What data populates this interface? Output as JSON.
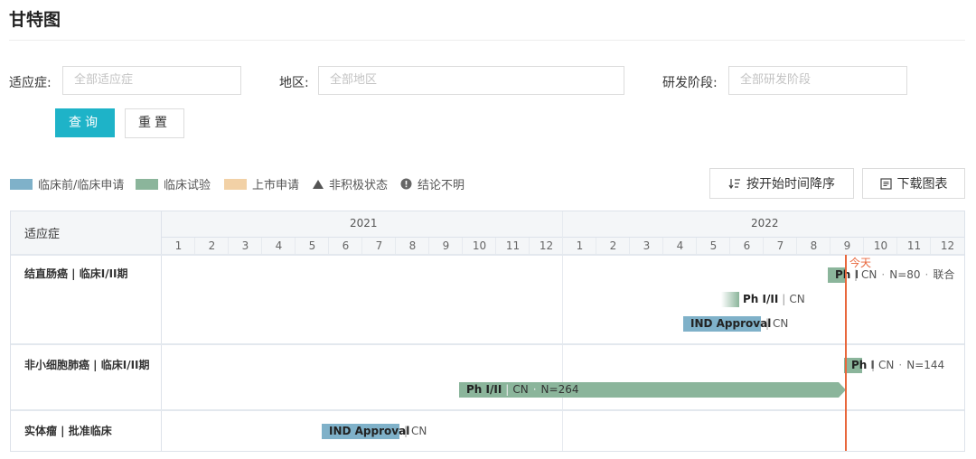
{
  "page": {
    "title": "甘特图"
  },
  "filters": {
    "indication": {
      "label": "适应症:",
      "placeholder": "全部适应症"
    },
    "region": {
      "label": "地区:",
      "placeholder": "全部地区"
    },
    "stage": {
      "label": "研发阶段:",
      "placeholder": "全部研发阶段"
    },
    "query_button": "查询",
    "reset_button": "重置"
  },
  "legend": {
    "preclinical": {
      "label": "临床前/临床申请",
      "color": "#7fb1c9"
    },
    "clinical": {
      "label": "临床试验",
      "color": "#8bb59b"
    },
    "market": {
      "label": "上市申请",
      "color": "#f2d1a6"
    },
    "inactive": {
      "label": "非积极状态",
      "icon": "triangle-icon"
    },
    "unknown": {
      "label": "结论不明",
      "icon": "info-circle-icon"
    }
  },
  "toolbar": {
    "sort_button": "按开始时间降序",
    "download_button": "下载图表"
  },
  "gantt": {
    "column_header": "适应症",
    "years": [
      "2021",
      "2022"
    ],
    "months": [
      "1",
      "2",
      "3",
      "4",
      "5",
      "6",
      "7",
      "8",
      "9",
      "10",
      "11",
      "12"
    ],
    "today_label": "今天",
    "today_color": "#e8673c",
    "rows": [
      {
        "indication": "结直肠癌 | 临床I/II期",
        "bars": [
          {
            "phase": "Ph I",
            "region": "CN",
            "n": "N=80",
            "extra": "联合",
            "type": "clinical"
          },
          {
            "phase": "Ph I/II",
            "region": "CN",
            "type": "clinical"
          },
          {
            "phase": "IND Approval",
            "region": "CN",
            "type": "preclinical"
          }
        ]
      },
      {
        "indication": "非小细胞肺癌 | 临床I/II期",
        "bars": [
          {
            "phase": "Ph I",
            "region": "CN",
            "n": "N=144",
            "type": "clinical"
          },
          {
            "phase": "Ph I/II",
            "region": "CN",
            "n": "N=264",
            "type": "clinical"
          }
        ]
      },
      {
        "indication": "实体瘤 | 批准临床",
        "bars": [
          {
            "phase": "IND Approval",
            "region": "CN",
            "type": "preclinical"
          }
        ]
      }
    ]
  }
}
